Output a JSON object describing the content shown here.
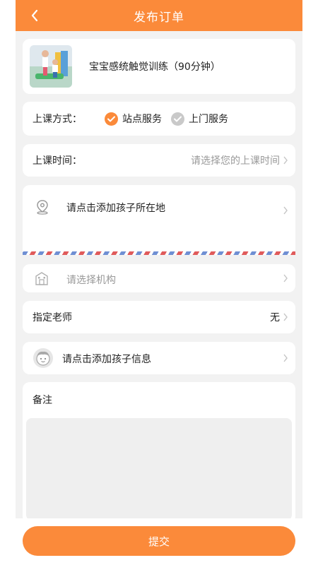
{
  "header": {
    "title": "发布订单",
    "back_icon": "chevron-left-icon"
  },
  "product": {
    "name": "宝宝感统触觉训练（90分钟）"
  },
  "service_mode": {
    "label": "上课方式：",
    "options": [
      {
        "label": "站点服务",
        "selected": true
      },
      {
        "label": "上门服务",
        "selected": false
      }
    ]
  },
  "class_time": {
    "label": "上课时间：",
    "placeholder": "请选择您的上课时间"
  },
  "location": {
    "prompt": "请点击添加孩子所在地",
    "icon": "location-pin-icon"
  },
  "institution": {
    "placeholder": "请选择机构",
    "icon": "building-icon"
  },
  "teacher": {
    "label": "指定老师",
    "value": "无"
  },
  "child_info": {
    "prompt": "请点击添加孩子信息",
    "icon": "child-avatar-icon"
  },
  "remark": {
    "label": "备注"
  },
  "submit": {
    "label": "提交"
  },
  "colors": {
    "accent": "#fb8a3a",
    "page_bg": "#f2f2f2",
    "airmail_red": "#e05b5b",
    "airmail_blue": "#6f8fd3"
  }
}
